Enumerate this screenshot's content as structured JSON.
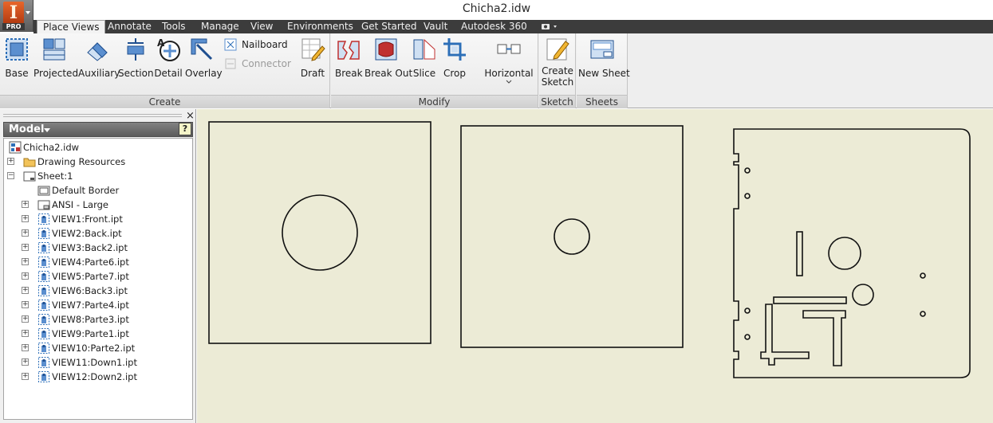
{
  "window": {
    "title": "Chicha2.idw"
  },
  "app_button": {
    "logo_letter": "I",
    "badge": "PRO"
  },
  "tabs": [
    {
      "label": "Place Views",
      "active": true
    },
    {
      "label": "Annotate"
    },
    {
      "label": "Tools"
    },
    {
      "label": "Manage"
    },
    {
      "label": "View"
    },
    {
      "label": "Environments"
    },
    {
      "label": "Get Started"
    },
    {
      "label": "Vault"
    },
    {
      "label": "Autodesk 360"
    }
  ],
  "ribbon": {
    "create": {
      "title": "Create",
      "buttons": [
        "Base",
        "Projected",
        "Auxiliary",
        "Section",
        "Detail",
        "Overlay"
      ],
      "small": [
        {
          "label": "Nailboard",
          "enabled": true
        },
        {
          "label": "Connector",
          "enabled": false
        }
      ],
      "draft": "Draft"
    },
    "modify": {
      "title": "Modify",
      "buttons": [
        "Break",
        "Break Out",
        "Slice",
        "Crop"
      ],
      "horizontal": "Horizontal"
    },
    "sketch": {
      "title": "Sketch",
      "line1": "Create",
      "line2": "Sketch"
    },
    "sheets": {
      "title": "Sheets",
      "new_sheet": "New Sheet"
    }
  },
  "browser": {
    "header": "Model",
    "close_glyph": "×",
    "help_glyph": "?",
    "tree": [
      {
        "label": "Chicha2.idw",
        "icon": "drawing-file-icon",
        "level": 0,
        "expander": ""
      },
      {
        "label": "Drawing Resources",
        "icon": "folder-icon",
        "level": 1,
        "expander": "+"
      },
      {
        "label": "Sheet:1",
        "icon": "sheet-icon",
        "level": 1,
        "expander": "−"
      },
      {
        "label": "Default Border",
        "icon": "border-icon",
        "level": 2,
        "expander": ""
      },
      {
        "label": "ANSI - Large",
        "icon": "titleblock-icon",
        "level": 2,
        "expander": "+"
      },
      {
        "label": "VIEW1:Front.ipt",
        "icon": "view-icon",
        "level": 2,
        "expander": "+"
      },
      {
        "label": "VIEW2:Back.ipt",
        "icon": "view-icon",
        "level": 2,
        "expander": "+"
      },
      {
        "label": "VIEW3:Back2.ipt",
        "icon": "view-icon",
        "level": 2,
        "expander": "+"
      },
      {
        "label": "VIEW4:Parte6.ipt",
        "icon": "view-icon",
        "level": 2,
        "expander": "+"
      },
      {
        "label": "VIEW5:Parte7.ipt",
        "icon": "view-icon",
        "level": 2,
        "expander": "+"
      },
      {
        "label": "VIEW6:Back3.ipt",
        "icon": "view-icon",
        "level": 2,
        "expander": "+"
      },
      {
        "label": "VIEW7:Parte4.ipt",
        "icon": "view-icon",
        "level": 2,
        "expander": "+"
      },
      {
        "label": "VIEW8:Parte3.ipt",
        "icon": "view-icon",
        "level": 2,
        "expander": "+"
      },
      {
        "label": "VIEW9:Parte1.ipt",
        "icon": "view-icon",
        "level": 2,
        "expander": "+"
      },
      {
        "label": "VIEW10:Parte2.ipt",
        "icon": "view-icon",
        "level": 2,
        "expander": "+"
      },
      {
        "label": "VIEW11:Down1.ipt",
        "icon": "view-icon",
        "level": 2,
        "expander": "+"
      },
      {
        "label": "VIEW12:Down2.ipt",
        "icon": "view-icon",
        "level": 2,
        "expander": "+"
      }
    ]
  },
  "colors": {
    "canvas": "#ecebd6",
    "tab_strip": "#3c3c3c",
    "ribbon": "#eeeeee",
    "accent_blue": "#2d6fb8"
  }
}
